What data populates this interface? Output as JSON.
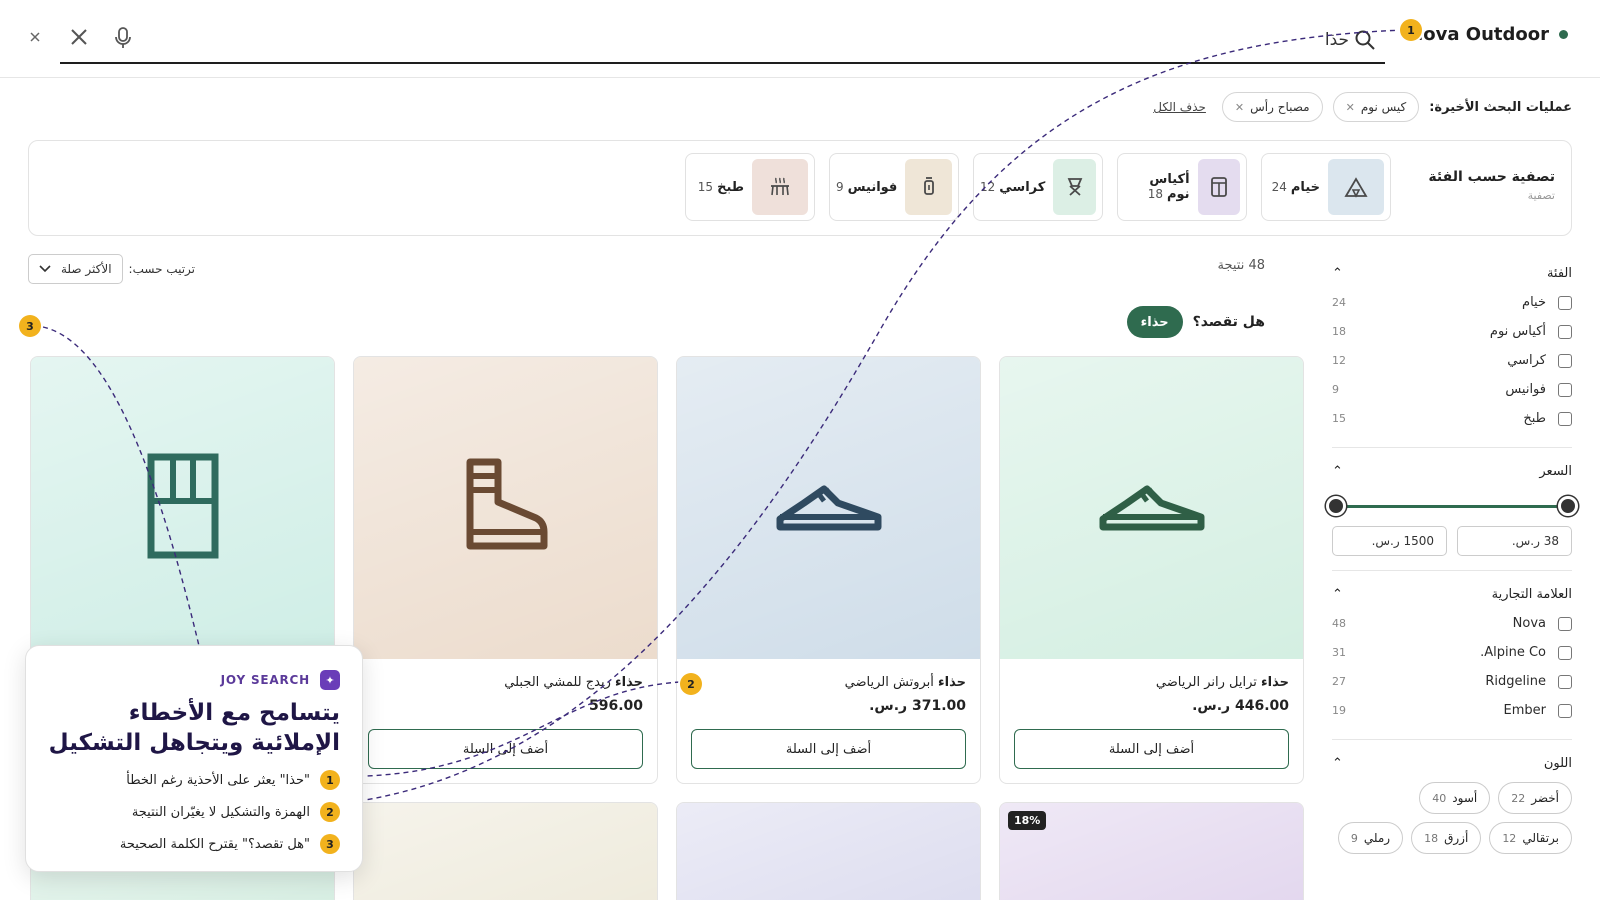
{
  "header": {
    "brand": "Nova Outdoor",
    "search_value": "حذا",
    "icons": [
      "search-icon",
      "mic-icon",
      "close-icon",
      "close-small-icon"
    ]
  },
  "recent": {
    "label": "عمليات البحث الأخيرة:",
    "chips": [
      "كيس نوم",
      "مصباح رأس"
    ],
    "clear_all": "حذف الكل"
  },
  "category_bar": {
    "title": "تصفية حسب الفئة",
    "subtitle": "تصفية",
    "items": [
      {
        "name": "خيام",
        "count": "24",
        "color": "#dbe6ee",
        "icon": "tent-icon"
      },
      {
        "name": "أكياس نوم",
        "count": "18",
        "color": "#e4dcef",
        "icon": "sleeping-bag-icon"
      },
      {
        "name": "كراسي",
        "count": "12",
        "color": "#dcefe5",
        "icon": "chair-icon"
      },
      {
        "name": "فوانيس",
        "count": "9",
        "color": "#efe6d7",
        "icon": "lantern-icon"
      },
      {
        "name": "طبخ",
        "count": "15",
        "color": "#efe0da",
        "icon": "cooking-icon"
      }
    ]
  },
  "sidebar": {
    "category": {
      "title": "الفئة",
      "items": [
        {
          "label": "خيام",
          "count": "24"
        },
        {
          "label": "أكياس نوم",
          "count": "18"
        },
        {
          "label": "كراسي",
          "count": "12"
        },
        {
          "label": "فوانيس",
          "count": "9"
        },
        {
          "label": "طبخ",
          "count": "15"
        }
      ]
    },
    "price": {
      "title": "السعر",
      "min": "38 ر.س.",
      "max": "1500 ر.س."
    },
    "brand": {
      "title": "العلامة التجارية",
      "items": [
        {
          "label": "Nova",
          "count": "48"
        },
        {
          "label": "Alpine Co.",
          "count": "31"
        },
        {
          "label": "Ridgeline",
          "count": "27"
        },
        {
          "label": "Ember",
          "count": "19"
        }
      ]
    },
    "color": {
      "title": "اللون",
      "items": [
        {
          "label": "أخضر",
          "count": "22"
        },
        {
          "label": "أسود",
          "count": "40"
        },
        {
          "label": "برتقالي",
          "count": "12"
        },
        {
          "label": "أزرق",
          "count": "18"
        },
        {
          "label": "رملي",
          "count": "9"
        }
      ]
    }
  },
  "results": {
    "count_text": "48 نتيجة",
    "sort_label": "ترتيب حسب:",
    "sort_value": "الأكثر صلة",
    "did_you_mean": "هل تقصد؟",
    "suggestion": "حذاء"
  },
  "products": [
    {
      "bold": "حذاء",
      "rest": " ترايل رانر الرياضي",
      "price": "446.00 ر.س.",
      "add": "أضف إلى السلة",
      "bg": "#d4efe2",
      "fg": "#2f5f46",
      "icon": "sneaker-icon"
    },
    {
      "bold": "حذاء",
      "rest": " أبروتش الرياضي",
      "price": "371.00 ر.س.",
      "add": "أضف إلى السلة",
      "bg": "#cfdde9",
      "fg": "#2f4a60",
      "icon": "sneaker-icon"
    },
    {
      "bold": "حذاء",
      "rest": " ريدج للمشي الجبلي",
      "price": "596.00",
      "add": "أضف إلى السلة",
      "bg": "#ecdccd",
      "fg": "#6a4a33",
      "icon": "boot-icon"
    },
    {
      "bold": "",
      "rest": "",
      "price": "",
      "add": "",
      "bg": "#cfeee6",
      "fg": "#2f6b5e",
      "icon": "box-icon"
    }
  ],
  "row2": [
    {
      "bg": "#e2d6ee",
      "badge": "18%"
    },
    {
      "bg": "#dcdcef",
      "badge": ""
    },
    {
      "bg": "#eeeadb",
      "badge": ""
    },
    {
      "bg": "#d6eee2",
      "badge": ""
    }
  ],
  "joy": {
    "tag": "JOY SEARCH",
    "title": "يتسامح مع الأخطاء الإملائية ويتجاهل التشكيل",
    "points": [
      {
        "n": "1",
        "text": "\"حذا\" يعثر على الأحذية رغم الخطأ"
      },
      {
        "n": "2",
        "text": "الهمزة والتشكيل لا يغيّران النتيجة"
      },
      {
        "n": "3",
        "text": "\"هل تقصد؟\" يقترح الكلمة الصحيحة"
      }
    ]
  },
  "markers": [
    "1",
    "2",
    "3"
  ],
  "colors": {
    "accent": "#2f6b4f",
    "marker": "#f2b21d",
    "joy_title": "#1f1646",
    "joy_tag": "#5b3a9a"
  }
}
